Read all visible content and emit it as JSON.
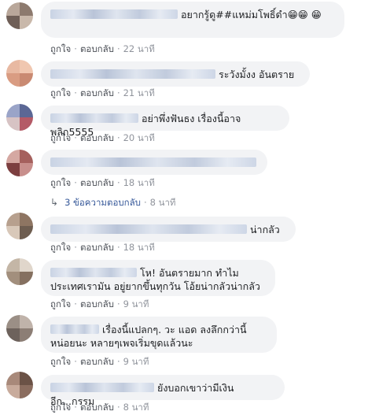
{
  "comments": [
    {
      "text": "อยากรู้ดู##แหม่มโพธิ์ดำ😁😁 😁",
      "like": "ถูกใจ",
      "reply": "ตอบกลับ",
      "time": "22 นาที"
    },
    {
      "text": "ระวังมั้งง อันตราย",
      "like": "ถูกใจ",
      "reply": "ตอบกลับ",
      "time": "21 นาที"
    },
    {
      "text": "อย่าพึ่งฟันธง เรื่องนี้อาจพลิก5555",
      "like": "ถูกใจ",
      "reply": "ตอบกลับ",
      "time": "20 นาที"
    },
    {
      "text": "",
      "like": "ถูกใจ",
      "reply": "ตอบกลับ",
      "time": "18 นาที"
    },
    {
      "text": "น่ากลัว",
      "like": "ถูกใจ",
      "reply": "ตอบกลับ",
      "time": "18 นาที"
    },
    {
      "text": "โห! อันตรายมาก ทำไมประเทศเรามัน อยู่ยากขึ้นทุกวัน โอ้ยน่ากลัวน่ากลัว",
      "like": "ถูกใจ",
      "reply": "ตอบกลับ",
      "time": "9 นาที"
    },
    {
      "text": "เรื่องนี้แปลกๆ. วะ แอด ลงลึกกว่านี้หน่อยนะ หลายๆเพจเริ่มขุดแล้วนะ",
      "like": "ถูกใจ",
      "reply": "ตอบกลับ",
      "time": "9 นาที"
    },
    {
      "text": "ยังบอกเขาว่ามีเงินอีก...กรรม",
      "like": "ถูกใจ",
      "reply": "ตอบกลับ",
      "time": "8 นาที"
    }
  ],
  "replies": {
    "label": "3 ข้อความตอบกลับ",
    "time": "8 นาที",
    "icon": "reply-arrow-icon"
  },
  "colors": {
    "bubble": "#f2f3f5",
    "link": "#365899",
    "meta": "#90949c"
  }
}
